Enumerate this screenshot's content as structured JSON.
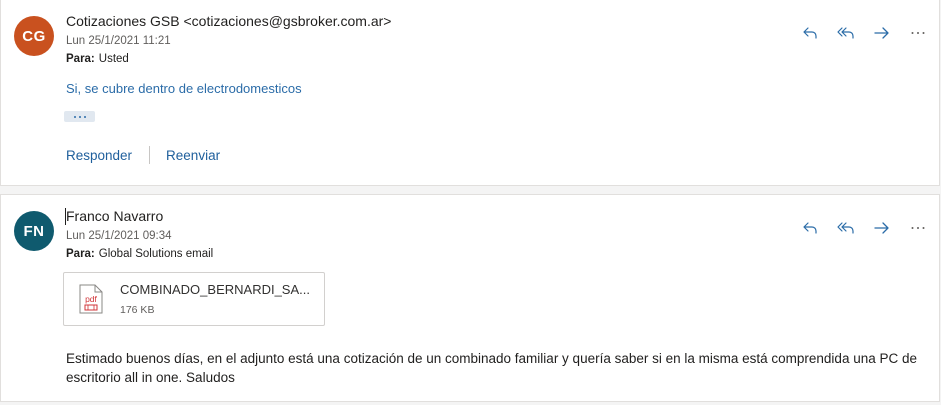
{
  "colors": {
    "avatar_cg": "#c9511f",
    "avatar_fn": "#0f5a6e",
    "accent": "#2b6ca8",
    "pdf_red": "#d13438"
  },
  "messages": [
    {
      "avatar_initials": "CG",
      "sender": "Cotizaciones GSB <cotizaciones@gsbroker.com.ar>",
      "date": "Lun 25/1/2021 11:21",
      "to_label": "Para:",
      "to_value": "Usted",
      "body_text": "Si, se cubre dentro de electrodomesticos",
      "reply_label": "Responder",
      "forward_label": "Reenviar"
    },
    {
      "avatar_initials": "FN",
      "sender": "Franco Navarro",
      "date": "Lun 25/1/2021 09:34",
      "to_label": "Para:",
      "to_value": "Global Solutions email",
      "attachment": {
        "icon": "pdf-file-icon",
        "icon_text": "pdf",
        "name": "COMBINADO_BERNARDI_SA...",
        "size": "176 KB"
      },
      "body_text": "Estimado buenos días, en el adjunto está una cotización de un combinado familiar y quería saber si en la misma está comprendida una PC de escritorio all in one. Saludos"
    }
  ],
  "action_icons": [
    "reply-icon",
    "reply-all-icon",
    "forward-icon",
    "more-icon"
  ]
}
